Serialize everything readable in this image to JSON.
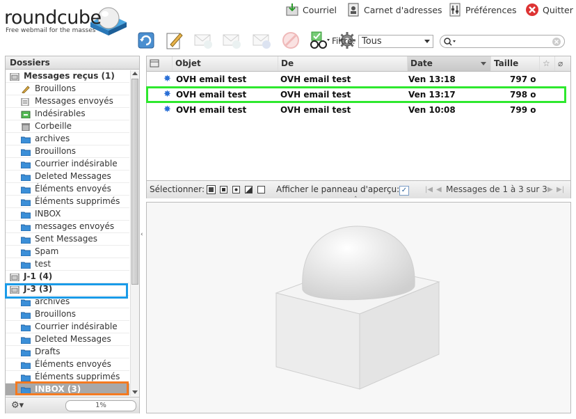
{
  "app": {
    "logo_text": "roundcube",
    "logo_tagline": "Free webmail for the masses"
  },
  "topnav": {
    "mail": "Courriel",
    "addressbook": "Carnet d'adresses",
    "preferences": "Préférences",
    "logout": "Quitter"
  },
  "toolbar": {
    "filter_label": "Filtre:",
    "filter_value": "Tous",
    "search_placeholder": ""
  },
  "folders": {
    "title": "Dossiers",
    "items": [
      {
        "label": "Messages reçus (1)",
        "icon": "inbox-icon",
        "bold": true
      },
      {
        "label": "Brouillons",
        "icon": "pencil-icon"
      },
      {
        "label": "Messages envoyés",
        "icon": "sent-icon"
      },
      {
        "label": "Indésirables",
        "icon": "junk-icon"
      },
      {
        "label": "Corbeille",
        "icon": "trash-icon"
      },
      {
        "label": "archives",
        "icon": "folder-icon"
      },
      {
        "label": "Brouillons",
        "icon": "folder-icon"
      },
      {
        "label": "Courrier indésirable",
        "icon": "folder-icon"
      },
      {
        "label": "Deleted Messages",
        "icon": "folder-icon"
      },
      {
        "label": "Éléments envoyés",
        "icon": "folder-icon"
      },
      {
        "label": "Éléments supprimés",
        "icon": "folder-icon"
      },
      {
        "label": "INBOX",
        "icon": "folder-icon"
      },
      {
        "label": "messages envoyés",
        "icon": "folder-icon"
      },
      {
        "label": "Sent Messages",
        "icon": "folder-icon"
      },
      {
        "label": "Spam",
        "icon": "folder-icon"
      },
      {
        "label": "test",
        "icon": "folder-icon"
      },
      {
        "label": "J-1 (4)",
        "icon": "account-icon",
        "bold": true
      },
      {
        "label": "J-3 (3)",
        "icon": "account-icon",
        "bold": true
      },
      {
        "label": "archives",
        "icon": "folder-icon"
      },
      {
        "label": "Brouillons",
        "icon": "folder-icon"
      },
      {
        "label": "Courrier indésirable",
        "icon": "folder-icon"
      },
      {
        "label": "Deleted Messages",
        "icon": "folder-icon"
      },
      {
        "label": "Drafts",
        "icon": "folder-icon"
      },
      {
        "label": "Éléments envoyés",
        "icon": "folder-icon"
      },
      {
        "label": "Éléments supprimés",
        "icon": "folder-icon"
      },
      {
        "label": "INBOX (3)",
        "icon": "folder-icon",
        "bold": true,
        "selected": true
      }
    ],
    "quota": "1%"
  },
  "messagelist": {
    "columns": {
      "subject": "Objet",
      "from": "De",
      "date": "Date",
      "size": "Taille"
    },
    "rows": [
      {
        "subject": "OVH email test",
        "from": "OVH email test",
        "date": "Ven 13:18",
        "size": "797 o"
      },
      {
        "subject": "OVH email test",
        "from": "OVH email test",
        "date": "Ven 13:17",
        "size": "798 o"
      },
      {
        "subject": "OVH email test",
        "from": "OVH email test",
        "date": "Ven 10:08",
        "size": "799 o"
      }
    ],
    "footer": {
      "select_label": "Sélectionner:",
      "preview_label": "Afficher le panneau d'aperçu:",
      "count": "Messages de 1 à 3 sur 3"
    }
  }
}
